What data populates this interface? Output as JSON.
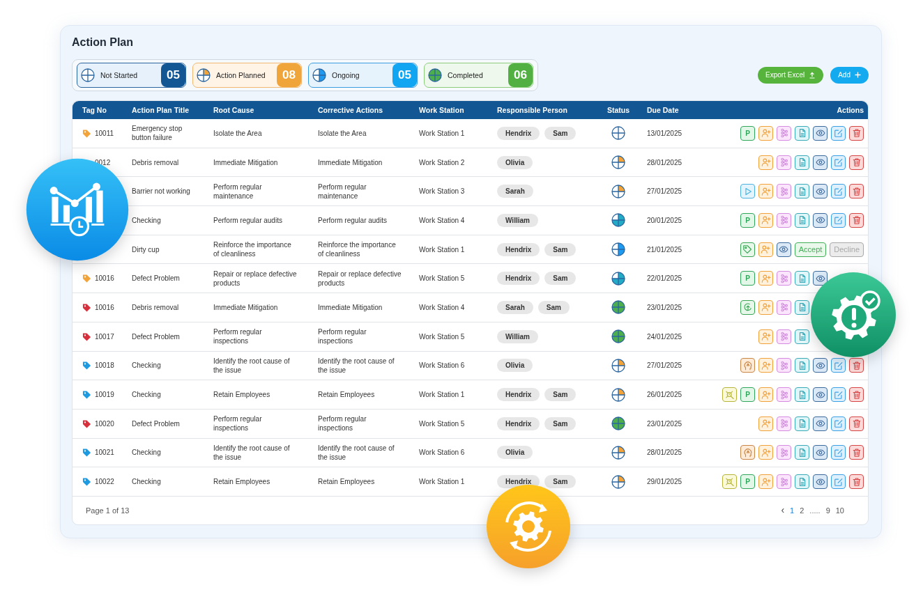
{
  "page": {
    "title": "Action Plan"
  },
  "status_filters": [
    {
      "kind": "not_started",
      "label": "Not Started",
      "count": "05"
    },
    {
      "kind": "action_planned",
      "label": "Action Planned",
      "count": "08"
    },
    {
      "kind": "ongoing",
      "label": "Ongoing",
      "count": "05"
    },
    {
      "kind": "completed",
      "label": "Completed",
      "count": "06"
    }
  ],
  "buttons": [
    {
      "kind": "export",
      "label": "Export Excel"
    },
    {
      "kind": "add",
      "label": "Add"
    }
  ],
  "table": {
    "columns": [
      "Tag No",
      "Action Plan Title",
      "Root Cause",
      "Corrective Actions",
      "Work Station",
      "Responsible Person",
      "Status",
      "Due Date",
      "Actions"
    ],
    "rows": [
      {
        "tag": {
          "number": "10011",
          "color": "#f2a33a"
        },
        "title": "Emergency stop button failure",
        "root_cause": "Isolate the Area",
        "corrective_action": "Isolate the Area",
        "work_station": "Work Station 1",
        "people": [
          "Hendrix",
          "Sam"
        ],
        "status": {
          "kind": "not_started"
        },
        "due_date": "13/01/2025",
        "actions": [
          {
            "kind": "p",
            "label": "P"
          },
          {
            "kind": "assign"
          },
          {
            "kind": "share"
          },
          {
            "kind": "pdf"
          },
          {
            "kind": "view"
          },
          {
            "kind": "edit"
          },
          {
            "kind": "delete"
          }
        ]
      },
      {
        "tag": {
          "number": "0012"
        },
        "title": "Debris removal",
        "root_cause": "Immediate Mitigation",
        "corrective_action": "Immediate Mitigation",
        "work_station": "Work Station 2",
        "people": [
          "Olivia"
        ],
        "status": {
          "kind": "action_planned"
        },
        "due_date": "28/01/2025",
        "actions": [
          {
            "kind": "assign"
          },
          {
            "kind": "share"
          },
          {
            "kind": "pdf"
          },
          {
            "kind": "view"
          },
          {
            "kind": "edit"
          },
          {
            "kind": "delete"
          }
        ]
      },
      {
        "title": "Barrier not working",
        "root_cause": "Perform regular maintenance",
        "corrective_action": "Perform regular maintenance",
        "work_station": "Work Station 3",
        "people": [
          "Sarah"
        ],
        "status": {
          "kind": "action_planned"
        },
        "due_date": "27/01/2025",
        "actions": [
          {
            "kind": "play"
          },
          {
            "kind": "assign"
          },
          {
            "kind": "share"
          },
          {
            "kind": "pdf"
          },
          {
            "kind": "view"
          },
          {
            "kind": "edit"
          },
          {
            "kind": "delete"
          }
        ]
      },
      {
        "title": "Checking",
        "root_cause": "Perform regular audits",
        "corrective_action": "Perform regular audits",
        "work_station": "Work Station 4",
        "people": [
          "William"
        ],
        "status": {
          "kind": "three_quarters"
        },
        "due_date": "20/01/2025",
        "actions": [
          {
            "kind": "p",
            "label": "P"
          },
          {
            "kind": "assign"
          },
          {
            "kind": "share"
          },
          {
            "kind": "pdf"
          },
          {
            "kind": "view"
          },
          {
            "kind": "edit"
          },
          {
            "kind": "delete"
          }
        ]
      },
      {
        "title": "Dirty cup",
        "root_cause": "Reinforce the importance of cleanliness",
        "corrective_action": "Reinforce the importance of cleanliness",
        "work_station": "Work Station 1",
        "people": [
          "Hendrix",
          "Sam"
        ],
        "status": {
          "kind": "ongoing"
        },
        "due_date": "21/01/2025",
        "actions": [
          {
            "kind": "tag"
          },
          {
            "kind": "assign"
          },
          {
            "kind": "view"
          },
          {
            "kind": "accept",
            "label": "Accept"
          },
          {
            "kind": "decline",
            "label": "Decline"
          }
        ]
      },
      {
        "tag": {
          "number": "10016",
          "color": "#f2a33a"
        },
        "title": "Defect Problem",
        "root_cause": "Repair or replace defective products",
        "corrective_action": "Repair or replace defective products",
        "work_station": "Work Station 5",
        "people": [
          "Hendrix",
          "Sam"
        ],
        "status": {
          "kind": "three_quarters"
        },
        "due_date": "22/01/2025",
        "actions": [
          {
            "kind": "p",
            "label": "P"
          },
          {
            "kind": "assign"
          },
          {
            "kind": "share"
          },
          {
            "kind": "pdf"
          },
          {
            "kind": "view"
          }
        ]
      },
      {
        "tag": {
          "number": "10016",
          "color": "#d7303c"
        },
        "title": "Debris removal",
        "root_cause": "Immediate Mitigation",
        "corrective_action": "Immediate Mitigation",
        "work_station": "Work Station 4",
        "people": [
          "Sarah",
          "Sam"
        ],
        "status": {
          "kind": "completed"
        },
        "due_date": "23/01/2025",
        "actions": [
          {
            "kind": "progress"
          },
          {
            "kind": "assign"
          },
          {
            "kind": "share"
          },
          {
            "kind": "pdf"
          }
        ]
      },
      {
        "tag": {
          "number": "10017",
          "color": "#d7303c"
        },
        "title": "Defect Problem",
        "root_cause": "Perform regular inspections",
        "corrective_action": "Perform regular inspections",
        "work_station": "Work Station 5",
        "people": [
          "William"
        ],
        "status": {
          "kind": "completed"
        },
        "due_date": "24/01/2025",
        "actions": [
          {
            "kind": "assign"
          },
          {
            "kind": "share"
          },
          {
            "kind": "pdf"
          }
        ]
      },
      {
        "tag": {
          "number": "10018",
          "color": "#1e9be0"
        },
        "title": "Checking",
        "root_cause": "Identify the root cause of the issue",
        "corrective_action": "Identify the root cause of the issue",
        "work_station": "Work Station 6",
        "people": [
          "Olivia"
        ],
        "status": {
          "kind": "action_planned"
        },
        "due_date": "27/01/2025",
        "actions": [
          {
            "kind": "head"
          },
          {
            "kind": "assign"
          },
          {
            "kind": "share"
          },
          {
            "kind": "pdf"
          },
          {
            "kind": "view"
          },
          {
            "kind": "edit"
          },
          {
            "kind": "delete"
          }
        ]
      },
      {
        "tag": {
          "number": "10019",
          "color": "#1e9be0"
        },
        "title": "Checking",
        "root_cause": "Retain Employees",
        "corrective_action": "Retain Employees",
        "work_station": "Work Station 1",
        "people": [
          "Hendrix",
          "Sam"
        ],
        "status": {
          "kind": "action_planned"
        },
        "due_date": "26/01/2025",
        "actions": [
          {
            "kind": "analysis"
          },
          {
            "kind": "p",
            "label": "P"
          },
          {
            "kind": "assign"
          },
          {
            "kind": "share"
          },
          {
            "kind": "pdf"
          },
          {
            "kind": "view"
          },
          {
            "kind": "edit"
          },
          {
            "kind": "delete"
          }
        ]
      },
      {
        "tag": {
          "number": "10020",
          "color": "#d7303c"
        },
        "title": "Defect Problem",
        "root_cause": "Perform regular inspections",
        "corrective_action": "Perform regular inspections",
        "work_station": "Work Station 5",
        "people": [
          "Hendrix",
          "Sam"
        ],
        "status": {
          "kind": "completed"
        },
        "due_date": "23/01/2025",
        "actions": [
          {
            "kind": "assign"
          },
          {
            "kind": "share"
          },
          {
            "kind": "pdf"
          },
          {
            "kind": "view"
          },
          {
            "kind": "edit"
          },
          {
            "kind": "delete"
          }
        ]
      },
      {
        "tag": {
          "number": "10021",
          "color": "#1e9be0"
        },
        "title": "Checking",
        "root_cause": "Identify the root cause of the issue",
        "corrective_action": "Identify the root cause of the issue",
        "work_station": "Work Station 6",
        "people": [
          "Olivia"
        ],
        "status": {
          "kind": "action_planned"
        },
        "due_date": "28/01/2025",
        "actions": [
          {
            "kind": "head"
          },
          {
            "kind": "assign"
          },
          {
            "kind": "share"
          },
          {
            "kind": "pdf"
          },
          {
            "kind": "view"
          },
          {
            "kind": "edit"
          },
          {
            "kind": "delete"
          }
        ]
      },
      {
        "tag": {
          "number": "10022",
          "color": "#1e9be0"
        },
        "title": "Checking",
        "root_cause": "Retain Employees",
        "corrective_action": "Retain Employees",
        "work_station": "Work Station 1",
        "people": [
          "Hendrix",
          "Sam"
        ],
        "status": {
          "kind": "action_planned"
        },
        "due_date": "29/01/2025",
        "actions": [
          {
            "kind": "analysis"
          },
          {
            "kind": "p",
            "label": "P"
          },
          {
            "kind": "assign"
          },
          {
            "kind": "share"
          },
          {
            "kind": "pdf"
          },
          {
            "kind": "view"
          },
          {
            "kind": "edit"
          },
          {
            "kind": "delete"
          }
        ]
      }
    ]
  },
  "pagination": {
    "summary": "Page 1 of 13",
    "pages": [
      {
        "kind": "prev",
        "label": "‹"
      },
      {
        "kind": "page",
        "label": "1",
        "selected": true
      },
      {
        "kind": "page",
        "label": "2",
        "selected": false
      },
      {
        "kind": "gap",
        "label": "....."
      },
      {
        "kind": "page",
        "label": "9",
        "selected": false
      },
      {
        "kind": "page",
        "label": "10",
        "selected": false
      }
    ]
  },
  "badges": [
    {
      "kind": "chart"
    },
    {
      "kind": "gear_alert"
    },
    {
      "kind": "gear_refresh"
    }
  ]
}
